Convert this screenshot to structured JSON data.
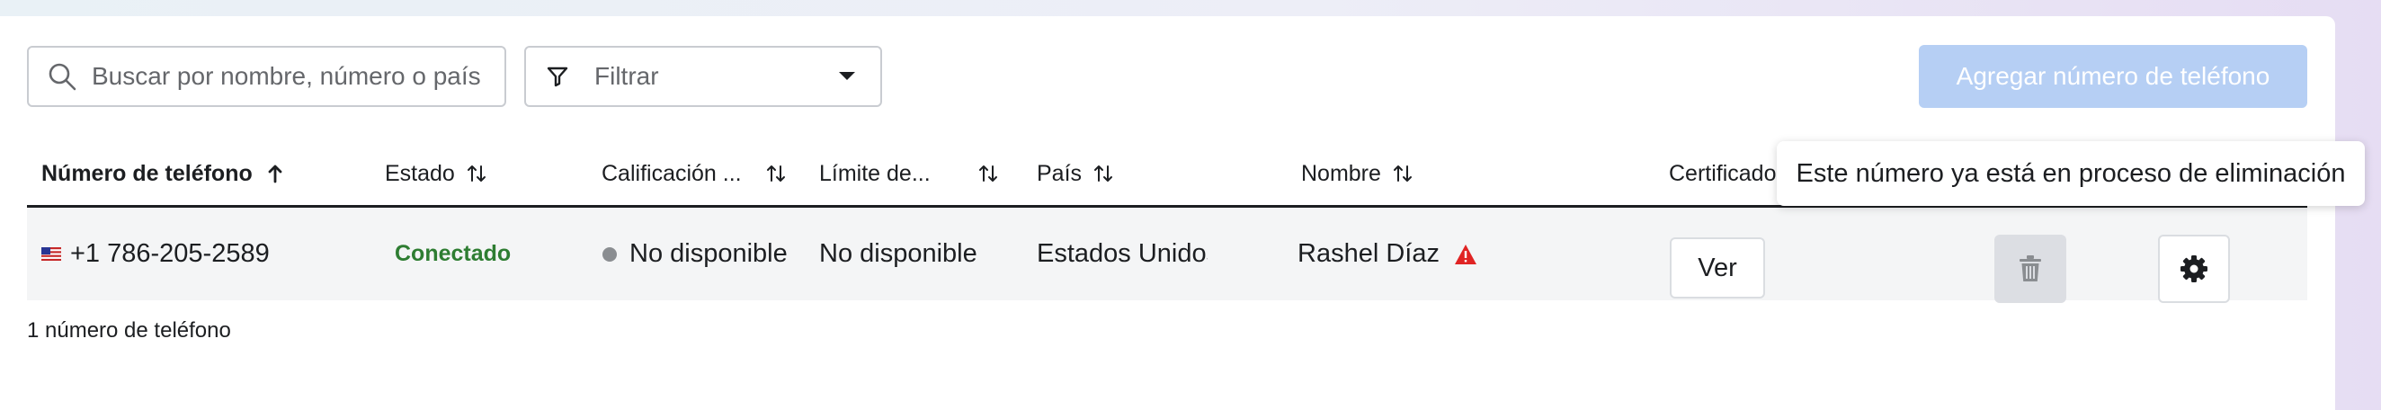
{
  "toolbar": {
    "search_placeholder": "Buscar por nombre, número o país",
    "filter_label": "Filtrar",
    "add_button_label": "Agregar número de teléfono"
  },
  "table": {
    "columns": [
      {
        "label": "Número de teléfono",
        "sort": "arrow-up-icon"
      },
      {
        "label": "Estado",
        "sort": "sort-icon"
      },
      {
        "label": "Calificación ...",
        "sort": "sort-icon"
      },
      {
        "label": "Límite de...",
        "sort": "sort-icon"
      },
      {
        "label": "País",
        "sort": "sort-icon"
      },
      {
        "label": "Nombre",
        "sort": "sort-icon"
      },
      {
        "label": "Certificado",
        "sort": ""
      }
    ],
    "rows": [
      {
        "flag": "us-flag-icon",
        "phone": "+1 786-205-2589",
        "status": "Conectado",
        "quality": "No disponible",
        "limit": "No disponible",
        "country": "Estados Unidos",
        "name": "Rashel Díaz",
        "certificate_button": "Ver"
      }
    ]
  },
  "tooltip": "Este número ya está en proceso de eliminación",
  "footer": {
    "count": "1 número de teléfono"
  },
  "colors": {
    "accent_disabled": "#b6cff4",
    "status_connected": "#2e7d32",
    "warning": "#e02424"
  }
}
